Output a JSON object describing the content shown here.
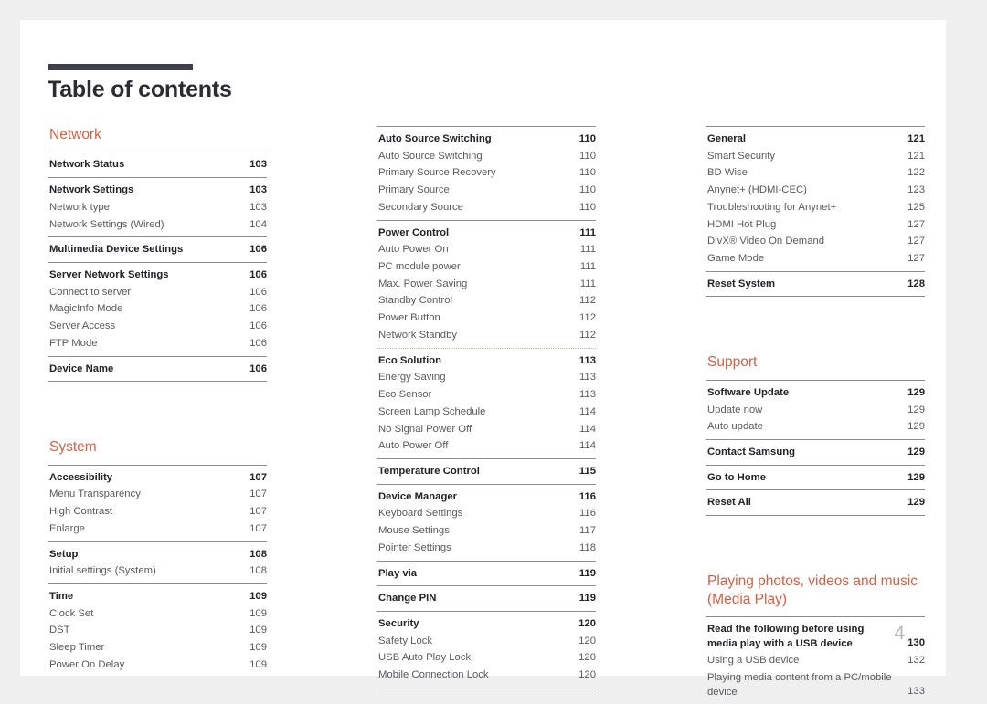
{
  "document": {
    "title": "Table of contents",
    "folio": "4",
    "accent_color": "#cf6246",
    "rule_color": "#8b8b8b",
    "title_bar_color": "#3f3f4b"
  },
  "columns": [
    {
      "name": "column-1",
      "sections": [
        {
          "heading": "Network",
          "groups": [
            {
              "entries": [
                {
                  "level": 1,
                  "label": "Network Status",
                  "page": "103"
                }
              ]
            },
            {
              "entries": [
                {
                  "level": 1,
                  "label": "Network Settings",
                  "page": "103"
                },
                {
                  "level": 2,
                  "label": "Network type",
                  "page": "103"
                },
                {
                  "level": 2,
                  "label": "Network Settings (Wired)",
                  "page": "104"
                }
              ]
            },
            {
              "entries": [
                {
                  "level": 1,
                  "label": "Multimedia Device Settings",
                  "page": "106"
                }
              ]
            },
            {
              "entries": [
                {
                  "level": 1,
                  "label": "Server Network Settings",
                  "page": "106"
                },
                {
                  "level": 2,
                  "label": "Connect to server",
                  "page": "106"
                },
                {
                  "level": 2,
                  "label": "MagicInfo Mode",
                  "page": "106"
                },
                {
                  "level": 2,
                  "label": "Server Access",
                  "page": "106"
                },
                {
                  "level": 2,
                  "label": "FTP Mode",
                  "page": "106"
                }
              ]
            },
            {
              "last": true,
              "entries": [
                {
                  "level": 1,
                  "label": "Device Name",
                  "page": "106"
                }
              ]
            }
          ]
        },
        {
          "heading": "System",
          "spaced": true,
          "groups": [
            {
              "entries": [
                {
                  "level": 1,
                  "label": "Accessibility",
                  "page": "107"
                },
                {
                  "level": 2,
                  "label": "Menu Transparency",
                  "page": "107"
                },
                {
                  "level": 2,
                  "label": "High Contrast",
                  "page": "107"
                },
                {
                  "level": 2,
                  "label": "Enlarge",
                  "page": "107"
                }
              ]
            },
            {
              "entries": [
                {
                  "level": 1,
                  "label": "Setup",
                  "page": "108"
                },
                {
                  "level": 2,
                  "label": "Initial settings (System)",
                  "page": "108"
                }
              ]
            },
            {
              "entries": [
                {
                  "level": 1,
                  "label": "Time",
                  "page": "109"
                },
                {
                  "level": 2,
                  "label": "Clock Set",
                  "page": "109"
                },
                {
                  "level": 2,
                  "label": "DST",
                  "page": "109"
                },
                {
                  "level": 2,
                  "label": "Sleep Timer",
                  "page": "109"
                },
                {
                  "level": 2,
                  "label": "Power On Delay",
                  "page": "109"
                }
              ]
            }
          ]
        }
      ]
    },
    {
      "name": "column-2",
      "sections": [
        {
          "heading": null,
          "groups": [
            {
              "entries": [
                {
                  "level": 1,
                  "label": "Auto Source Switching",
                  "page": "110"
                },
                {
                  "level": 2,
                  "label": "Auto Source Switching",
                  "page": "110"
                },
                {
                  "level": 2,
                  "label": "Primary Source Recovery",
                  "page": "110"
                },
                {
                  "level": 2,
                  "label": "Primary Source",
                  "page": "110"
                },
                {
                  "level": 2,
                  "label": "Secondary Source",
                  "page": "110"
                }
              ]
            },
            {
              "entries": [
                {
                  "level": 1,
                  "label": "Power Control",
                  "page": "111"
                },
                {
                  "level": 2,
                  "label": "Auto Power On",
                  "page": "111"
                },
                {
                  "level": 2,
                  "label": "PC module power",
                  "page": "111"
                },
                {
                  "level": 2,
                  "label": "Max. Power Saving",
                  "page": "111"
                },
                {
                  "level": 2,
                  "label": "Standby Control",
                  "page": "112"
                },
                {
                  "level": 2,
                  "label": "Power Button",
                  "page": "112"
                },
                {
                  "level": 2,
                  "label": "Network Standby",
                  "page": "112"
                }
              ]
            },
            {
              "dotted": true,
              "entries": [
                {
                  "level": 1,
                  "label": "Eco Solution",
                  "page": "113"
                },
                {
                  "level": 2,
                  "label": "Energy Saving",
                  "page": "113"
                },
                {
                  "level": 2,
                  "label": "Eco Sensor",
                  "page": "113"
                },
                {
                  "level": 2,
                  "label": "Screen Lamp Schedule",
                  "page": "114"
                },
                {
                  "level": 2,
                  "label": "No Signal Power Off",
                  "page": "114"
                },
                {
                  "level": 2,
                  "label": "Auto Power Off",
                  "page": "114"
                }
              ]
            },
            {
              "entries": [
                {
                  "level": 1,
                  "label": "Temperature Control",
                  "page": "115"
                }
              ]
            },
            {
              "entries": [
                {
                  "level": 1,
                  "label": "Device Manager",
                  "page": "116"
                },
                {
                  "level": 2,
                  "label": "Keyboard Settings",
                  "page": "116"
                },
                {
                  "level": 2,
                  "label": "Mouse Settings",
                  "page": "117"
                },
                {
                  "level": 2,
                  "label": "Pointer Settings",
                  "page": "118"
                }
              ]
            },
            {
              "entries": [
                {
                  "level": 1,
                  "label": "Play via",
                  "page": "119"
                }
              ]
            },
            {
              "entries": [
                {
                  "level": 1,
                  "label": "Change PIN",
                  "page": "119"
                }
              ]
            },
            {
              "last": true,
              "entries": [
                {
                  "level": 1,
                  "label": "Security",
                  "page": "120"
                },
                {
                  "level": 2,
                  "label": "Safety Lock",
                  "page": "120"
                },
                {
                  "level": 2,
                  "label": "USB Auto Play Lock",
                  "page": "120"
                },
                {
                  "level": 2,
                  "label": "Mobile Connection Lock",
                  "page": "120"
                }
              ]
            }
          ]
        }
      ]
    },
    {
      "name": "column-3",
      "sections": [
        {
          "heading": null,
          "groups": [
            {
              "entries": [
                {
                  "level": 1,
                  "label": "General",
                  "page": "121"
                },
                {
                  "level": 2,
                  "label": "Smart Security",
                  "page": "121"
                },
                {
                  "level": 2,
                  "label": "BD Wise",
                  "page": "122"
                },
                {
                  "level": 2,
                  "label": "Anynet+ (HDMI-CEC)",
                  "page": "123"
                },
                {
                  "level": 2,
                  "label": "Troubleshooting for Anynet+",
                  "page": "125"
                },
                {
                  "level": 2,
                  "label": "HDMI Hot Plug",
                  "page": "127"
                },
                {
                  "level": 2,
                  "label": "DivX® Video On Demand",
                  "page": "127"
                },
                {
                  "level": 2,
                  "label": "Game Mode",
                  "page": "127"
                }
              ]
            },
            {
              "last": true,
              "entries": [
                {
                  "level": 1,
                  "label": "Reset System",
                  "page": "128"
                }
              ]
            }
          ]
        },
        {
          "heading": "Support",
          "spaced": true,
          "groups": [
            {
              "entries": [
                {
                  "level": 1,
                  "label": "Software Update",
                  "page": "129"
                },
                {
                  "level": 2,
                  "label": "Update now",
                  "page": "129"
                },
                {
                  "level": 2,
                  "label": "Auto update",
                  "page": "129"
                }
              ]
            },
            {
              "entries": [
                {
                  "level": 1,
                  "label": "Contact Samsung",
                  "page": "129"
                }
              ]
            },
            {
              "entries": [
                {
                  "level": 1,
                  "label": "Go to Home",
                  "page": "129"
                }
              ]
            },
            {
              "last": true,
              "entries": [
                {
                  "level": 1,
                  "label": "Reset All",
                  "page": "129"
                }
              ]
            }
          ]
        },
        {
          "heading": "Playing photos, videos and music (Media Play)",
          "spaced": true,
          "groups": [
            {
              "entries": [
                {
                  "level": 1,
                  "label": "Read the following before using media play with a USB device",
                  "page": "130",
                  "multiline": true
                },
                {
                  "level": 2,
                  "label": "Using a USB device",
                  "page": "132"
                },
                {
                  "level": 2,
                  "label": "Playing media content from a PC/mobile device",
                  "page": "133",
                  "multiline": true
                }
              ]
            }
          ]
        }
      ]
    }
  ]
}
